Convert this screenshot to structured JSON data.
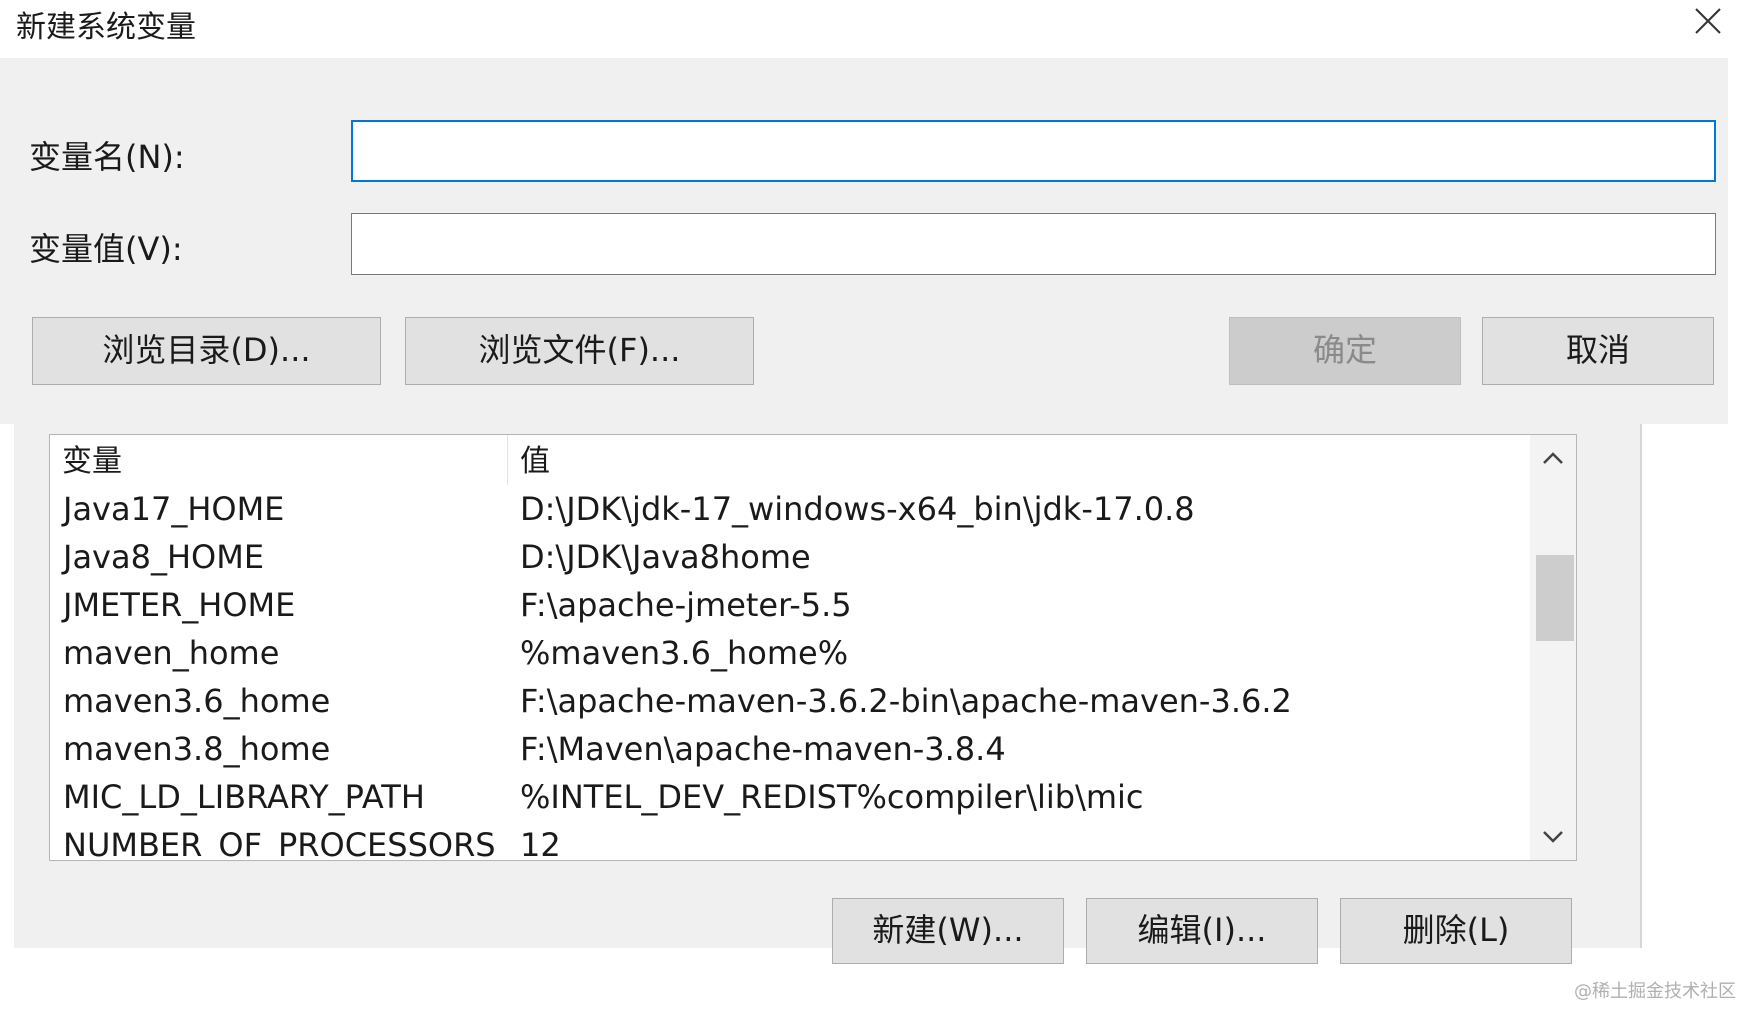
{
  "dialog": {
    "title": "新建系统变量",
    "name_label": "变量名(N):",
    "value_label": "变量值(V):",
    "name_value": "",
    "value_value": "",
    "browse_dir_label": "浏览目录(D)...",
    "browse_file_label": "浏览文件(F)...",
    "ok_label": "确定",
    "cancel_label": "取消"
  },
  "list": {
    "header_variable": "变量",
    "header_value": "值",
    "rows": [
      {
        "name": "Java17_HOME",
        "value": "D:\\JDK\\jdk-17_windows-x64_bin\\jdk-17.0.8"
      },
      {
        "name": "Java8_HOME",
        "value": "D:\\JDK\\Java8home"
      },
      {
        "name": "JMETER_HOME",
        "value": "F:\\apache-jmeter-5.5"
      },
      {
        "name": "maven_home",
        "value": "%maven3.6_home%"
      },
      {
        "name": "maven3.6_home",
        "value": "F:\\apache-maven-3.6.2-bin\\apache-maven-3.6.2"
      },
      {
        "name": "maven3.8_home",
        "value": "F:\\Maven\\apache-maven-3.8.4"
      },
      {
        "name": "MIC_LD_LIBRARY_PATH",
        "value": "%INTEL_DEV_REDIST%compiler\\lib\\mic"
      },
      {
        "name": "NUMBER_OF_PROCESSORS",
        "value": "12"
      }
    ]
  },
  "actions": {
    "new_label": "新建(W)...",
    "edit_label": "编辑(I)...",
    "delete_label": "删除(L)"
  },
  "watermark": "@稀土掘金技术社区"
}
